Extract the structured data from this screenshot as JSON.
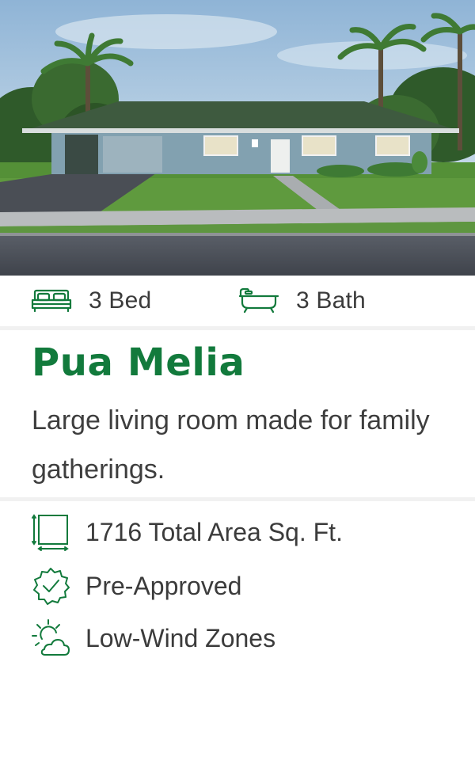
{
  "listing": {
    "beds": "3 Bed",
    "baths": "3 Bath",
    "title": "Pua Melia",
    "description": "Large living room made for family gatherings.",
    "features": [
      {
        "icon": "floor-area-icon",
        "label": "1716 Total Area Sq. Ft."
      },
      {
        "icon": "badge-check-icon",
        "label": "Pre-Approved"
      },
      {
        "icon": "sun-cloud-icon",
        "label": "Low-Wind Zones"
      }
    ]
  },
  "colors": {
    "brand_green": "#127a3c",
    "text": "#3b3b3b",
    "divider": "#f1f1f1"
  }
}
